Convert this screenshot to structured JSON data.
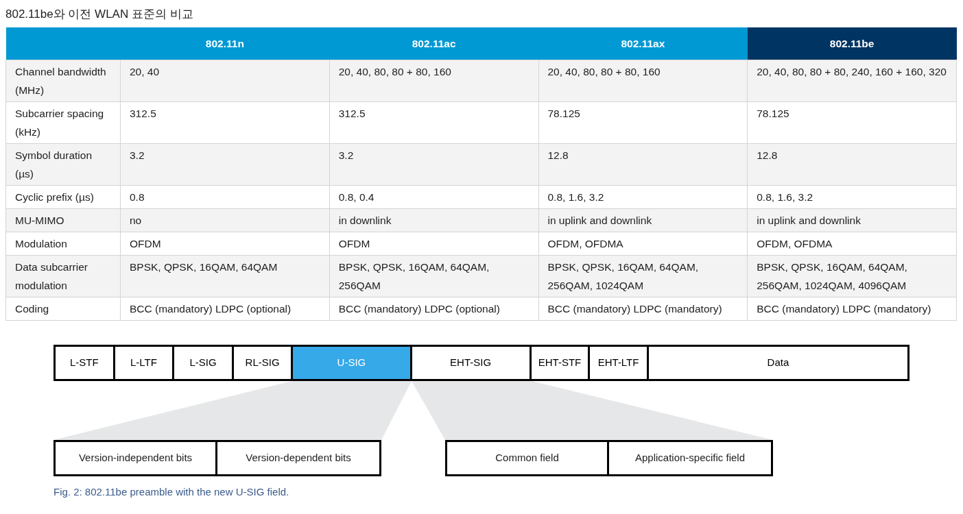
{
  "title": "802.11be와 이전 WLAN 표준의 비교",
  "table": {
    "columns": [
      {
        "highlighted": false
      },
      {
        "label": "802.11n",
        "highlighted": false
      },
      {
        "label": "802.11ac",
        "highlighted": false
      },
      {
        "label": "802.11ax",
        "highlighted": false
      },
      {
        "label": "802.11be",
        "highlighted": true
      }
    ],
    "rows": [
      {
        "shaded": true,
        "cells": [
          "Channel bandwidth (MHz)",
          "20, 40",
          "20, 40, 80, 80 + 80, 160",
          "20, 40, 80, 80 + 80, 160",
          "20, 40, 80, 80 + 80, 240, 160 + 160, 320"
        ]
      },
      {
        "shaded": false,
        "cells": [
          "Subcarrier spacing (kHz)",
          "312.5",
          "312.5",
          "78.125",
          "78.125"
        ]
      },
      {
        "shaded": true,
        "cells": [
          "Symbol duration (µs)",
          "3.2",
          "3.2",
          "12.8",
          "12.8"
        ]
      },
      {
        "shaded": false,
        "cells": [
          "Cyclic prefix (µs)",
          "0.8",
          "0.8, 0.4",
          "0.8, 1.6, 3.2",
          "0.8, 1.6, 3.2"
        ]
      },
      {
        "shaded": true,
        "cells": [
          "MU-MIMO",
          "no",
          "in downlink",
          "in uplink and downlink",
          "in uplink and downlink"
        ]
      },
      {
        "shaded": false,
        "cells": [
          "Modulation",
          "OFDM",
          "OFDM",
          "OFDM, OFDMA",
          "OFDM, OFDMA"
        ]
      },
      {
        "shaded": true,
        "cells": [
          "Data subcarrier modulation",
          "BPSK, QPSK, 16QAM, 64QAM",
          "BPSK, QPSK, 16QAM, 64QAM, 256QAM",
          "BPSK, QPSK, 16QAM, 64QAM, 256QAM, 1024QAM",
          "BPSK, QPSK, 16QAM, 64QAM, 256QAM, 1024QAM, 4096QAM"
        ]
      },
      {
        "shaded": false,
        "cells": [
          "Coding",
          "BCC (mandatory) LDPC (optional)",
          "BCC (mandatory) LDPC (optional)",
          "BCC (mandatory) LDPC (mandatory)",
          "BCC (mandatory) LDPC (mandatory)"
        ]
      }
    ]
  },
  "figure": {
    "preamble_fields": [
      {
        "label": "L-STF",
        "highlighted": false
      },
      {
        "label": "L-LTF",
        "highlighted": false
      },
      {
        "label": "L-SIG",
        "highlighted": false
      },
      {
        "label": "RL-SIG",
        "highlighted": false
      },
      {
        "label": "U-SIG",
        "highlighted": true
      },
      {
        "label": "EHT-SIG",
        "highlighted": false
      },
      {
        "label": "EHT-STF",
        "highlighted": false
      },
      {
        "label": "EHT-LTF",
        "highlighted": false
      },
      {
        "label": "Data",
        "highlighted": false
      }
    ],
    "u_sig_parts": [
      "Version-independent bits",
      "Version-dependent bits"
    ],
    "eht_sig_parts": [
      "Common field",
      "Application-specific field"
    ],
    "caption": "Fig. 2: 802.11be preamble with the new U-SIG field."
  }
}
